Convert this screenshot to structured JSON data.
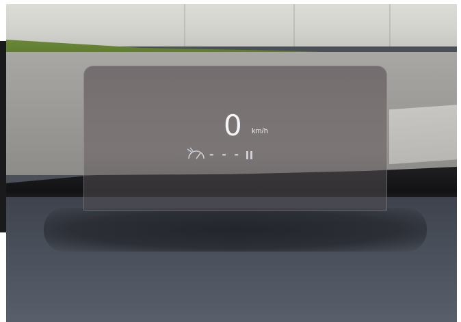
{
  "hud": {
    "speed": "0",
    "unit": "km/h",
    "limiter_placeholder": "- - -"
  },
  "icons": {
    "limiter": "speed-limiter-icon",
    "pause": "pause-icon"
  },
  "colors": {
    "hud_text": "#f4f4f6",
    "hud_dim": "#cfcfd6"
  }
}
